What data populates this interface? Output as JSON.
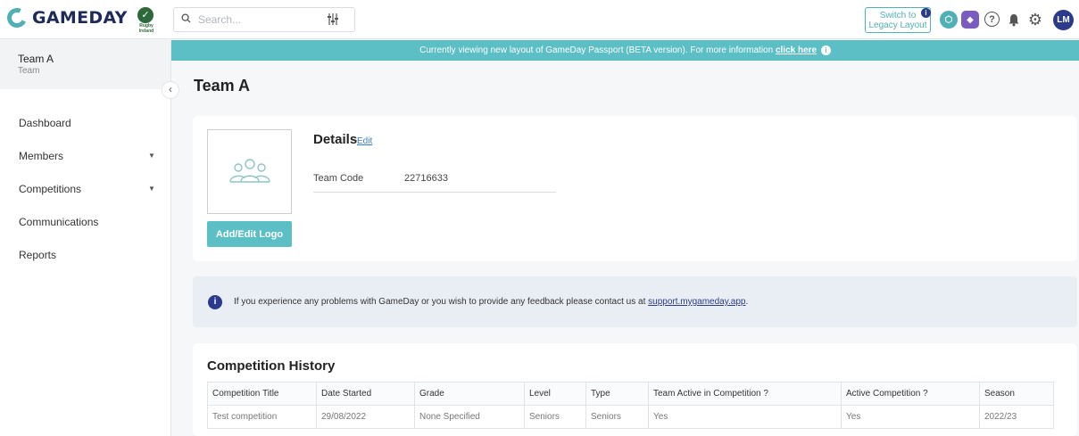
{
  "brand": {
    "logo_text": "GAMEDAY",
    "org_badge_text": "Rugby Ireland",
    "accent": "#5bbfc5",
    "navy": "#2b3a8c"
  },
  "topbar": {
    "search_placeholder": "Search...",
    "legacy_button_line1": "Switch to",
    "legacy_button_line2": "Legacy Layout",
    "avatar_initials": "LM",
    "icons": [
      "filter-icon",
      "passport-icon",
      "shield-icon",
      "help-icon",
      "bell-icon",
      "gear-icon"
    ]
  },
  "sidebar": {
    "team_name": "Team A",
    "team_type": "Team",
    "items": [
      {
        "label": "Dashboard",
        "has_caret": false
      },
      {
        "label": "Members",
        "has_caret": true
      },
      {
        "label": "Competitions",
        "has_caret": true
      },
      {
        "label": "Communications",
        "has_caret": false
      },
      {
        "label": "Reports",
        "has_caret": false
      }
    ]
  },
  "banner": {
    "text": "Currently viewing new layout of GameDay Passport (BETA version). For more information",
    "link": "click here"
  },
  "page": {
    "title": "Team A"
  },
  "details": {
    "title": "Details",
    "edit_label": "Edit",
    "logo_button": "Add/Edit Logo",
    "team_code_label": "Team Code",
    "team_code_value": "22716633"
  },
  "info": {
    "text": "If you experience any problems with GameDay or you wish to provide any feedback please contact us at",
    "link": "support.mygameday.app",
    "suffix": "."
  },
  "history": {
    "title": "Competition History",
    "columns": [
      "Competition Title",
      "Date Started",
      "Grade",
      "Level",
      "Type",
      "Team Active in Competition ?",
      "Active Competition ?",
      "Season"
    ],
    "rows": [
      [
        "Test competition",
        "29/08/2022",
        "None Specified",
        "Seniors",
        "Seniors",
        "Yes",
        "Yes",
        "2022/23"
      ]
    ]
  }
}
